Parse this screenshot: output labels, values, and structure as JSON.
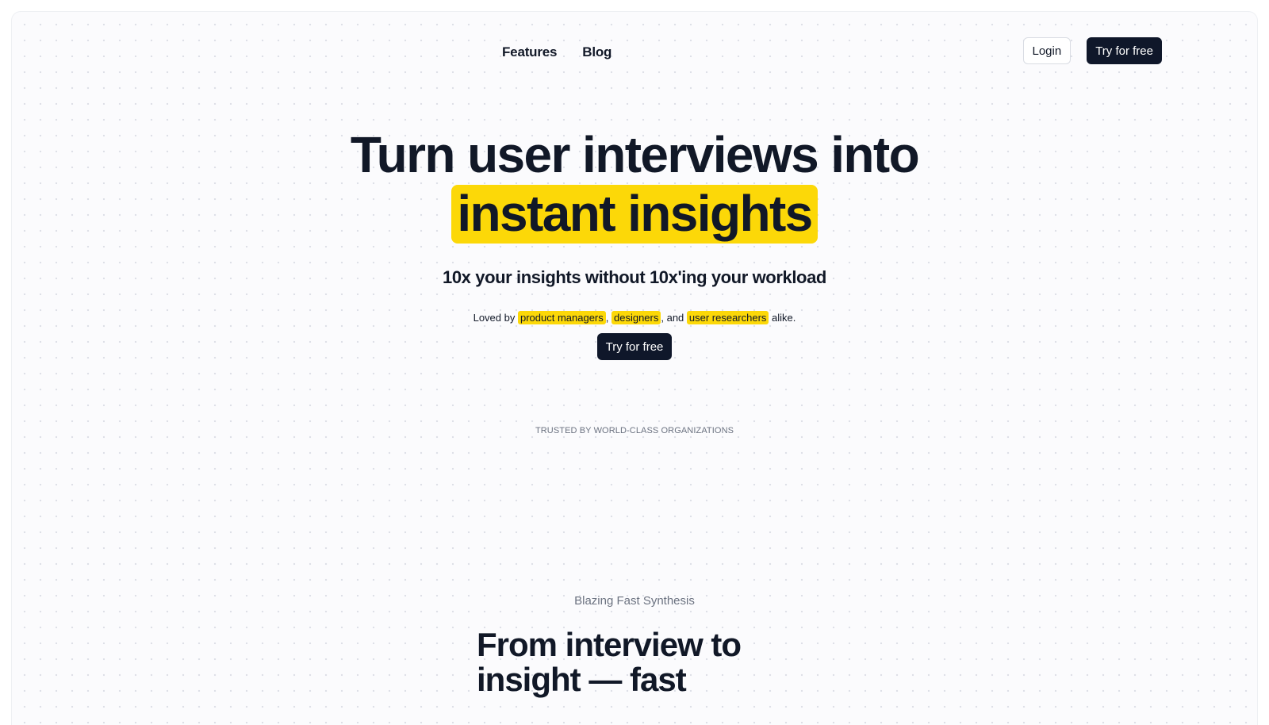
{
  "nav": {
    "links": [
      "Features",
      "Blog"
    ],
    "login_label": "Login",
    "cta_label": "Try for free"
  },
  "hero": {
    "title_line1": "Turn user interviews into",
    "title_line2": "instant insights",
    "subtitle": "10x your insights without 10x'ing your workload",
    "loved": {
      "prefix": "Loved by ",
      "role1": "product managers",
      "sep1": ", ",
      "role2": "designers",
      "sep2": ", and ",
      "role3": "user researchers",
      "suffix": " alike."
    },
    "cta_label": "Try for free"
  },
  "trusted_label": "TRUSTED BY WORLD-CLASS ORGANIZATIONS",
  "section": {
    "eyebrow": "Blazing Fast Synthesis",
    "title": "From interview to insight — fast"
  },
  "colors": {
    "accent": "#fcd808",
    "dark": "#0f172a",
    "text": "#111827",
    "muted": "#6b7280"
  }
}
